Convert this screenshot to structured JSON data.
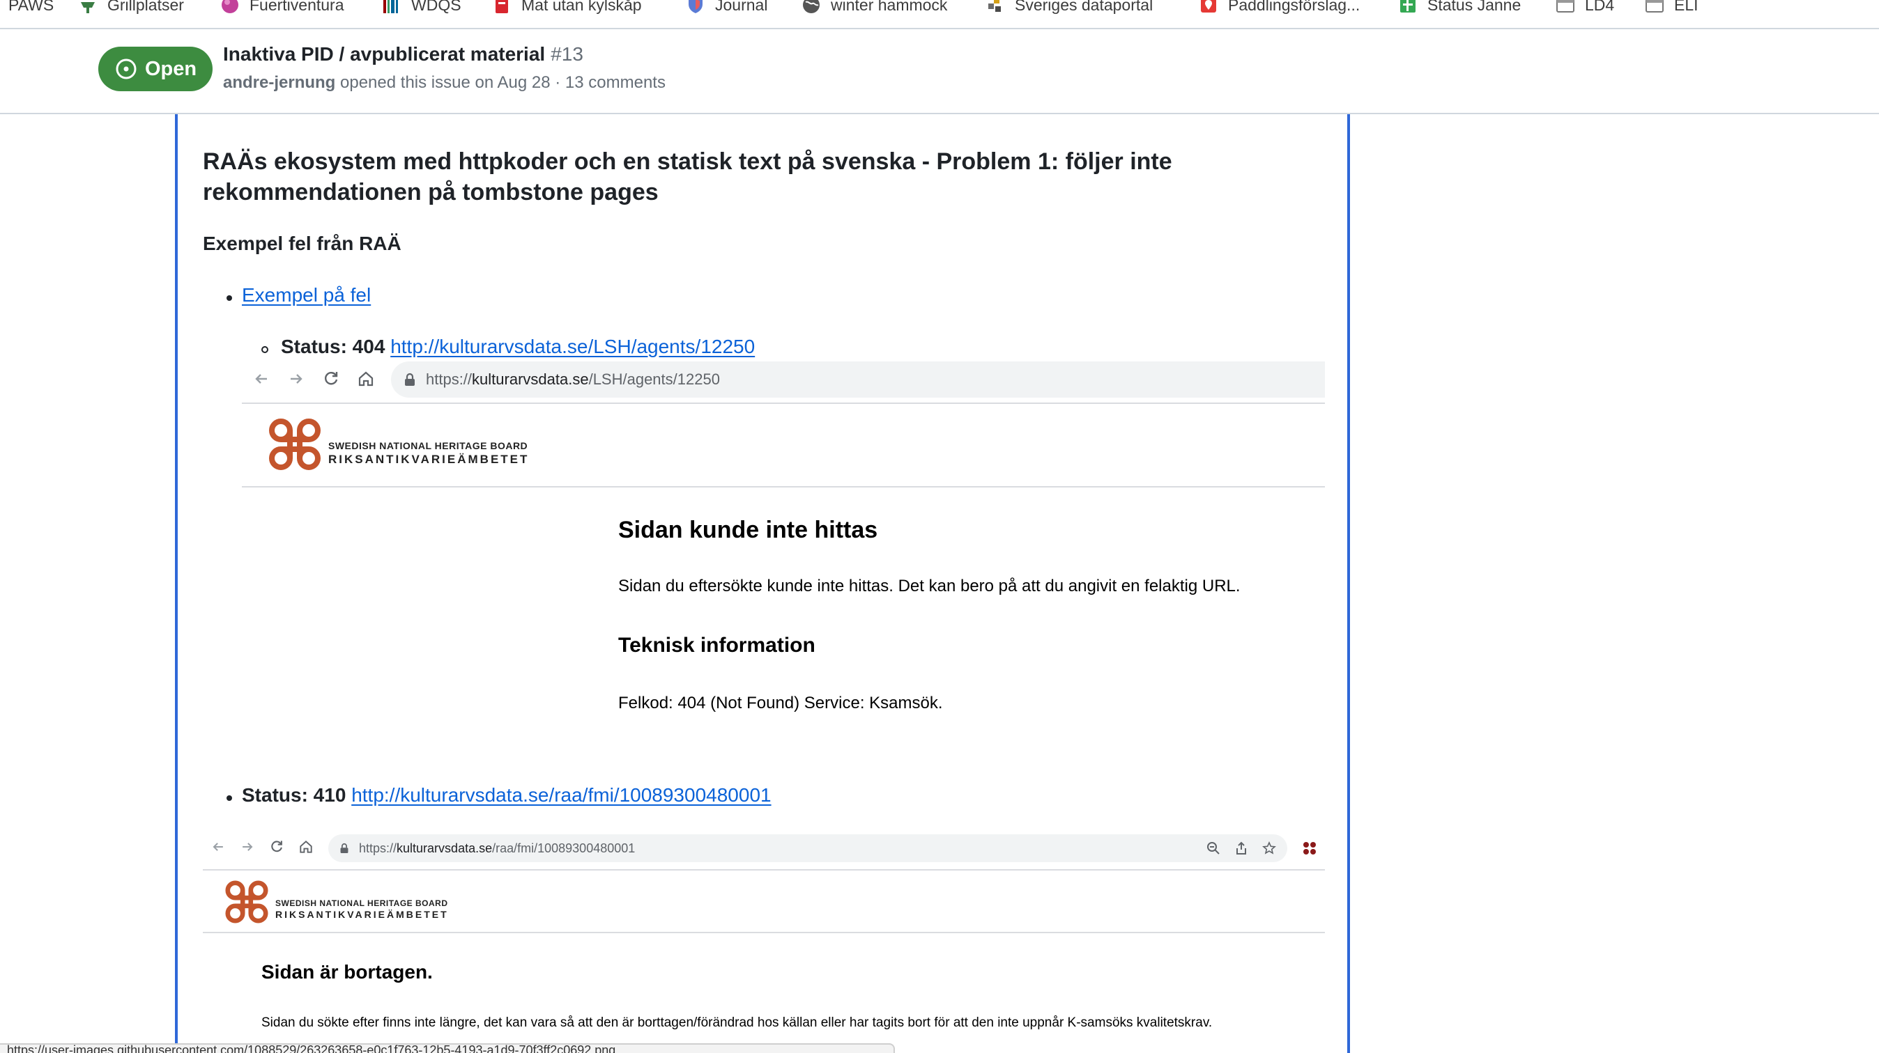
{
  "bookmarks": [
    {
      "label": "PAWS",
      "icon": "paws-icon"
    },
    {
      "label": "Grillplatser",
      "icon": "grill-icon"
    },
    {
      "label": "Fuertiventura",
      "icon": "globe-ball-icon"
    },
    {
      "label": "WDQS",
      "icon": "wdqs-icon"
    },
    {
      "label": "Mat utan kylskåp",
      "icon": "food-icon"
    },
    {
      "label": "Journal",
      "icon": "shield-icon"
    },
    {
      "label": "winter hammock",
      "icon": "world-icon"
    },
    {
      "label": "Sveriges dataportal",
      "icon": "dataportal-icon"
    },
    {
      "label": "Paddlingsförslag...",
      "icon": "map-pin-icon"
    },
    {
      "label": "Status Janne",
      "icon": "sheet-icon"
    },
    {
      "label": "LD4",
      "icon": "folder-icon"
    },
    {
      "label": "ELI",
      "icon": "folder-icon"
    }
  ],
  "issue": {
    "state_label": "Open",
    "title": "Inaktiva PID / avpublicerat material",
    "number": "#13",
    "author": "andre-jernung",
    "meta": "opened this issue on Aug 28 · 13 comments"
  },
  "comment": {
    "heading": "RAÄs ekosystem med httpkoder och en statisk text på svenska - Problem 1: följer inte rekommendationen på tombstone pages",
    "subheading": "Exempel fel från RAÄ",
    "item1_link": "Exempel på fel",
    "item1_1_status": "Status: 404",
    "item1_1_link": "http://kulturarvsdata.se/LSH/agents/12250",
    "item2_status": "Status: 410",
    "item2_link": "http://kulturarvsdata.se/raa/fmi/10089300480001"
  },
  "shot1": {
    "url_prefix": "https://",
    "url_domain": "kulturarvsdata.se",
    "url_path": "/LSH/agents/12250",
    "logo_line1": "SWEDISH NATIONAL HERITAGE BOARD",
    "logo_line2": "RIKSANTIKVARIEÄMBETET",
    "title": "Sidan kunde inte hittas",
    "text": "Sidan du eftersökte kunde inte hittas. Det kan bero på att du angivit en felaktig URL.",
    "h2": "Teknisk information",
    "code": "Felkod: 404 (Not Found) Service: Ksamsök."
  },
  "shot2": {
    "url_prefix": "https://",
    "url_domain": "kulturarvsdata.se",
    "url_path": "/raa/fmi/10089300480001",
    "logo_line1": "SWEDISH NATIONAL HERITAGE BOARD",
    "logo_line2": "RIKSANTIKVARIEÄMBETET",
    "title": "Sidan är bortagen.",
    "text": "Sidan du sökte efter finns inte längre, det kan vara så att den är borttagen/förändrad hos källan eller har tagits bort för att den inte uppnår K-samsöks kvalitetskrav."
  },
  "statusbar": {
    "text": "https://user-images.githubusercontent.com/1088529/263263658-e0c1f763-12b5-4193-a1d9-70f3ff2c0692.png"
  },
  "colors": {
    "open_green": "#3d8c40",
    "link_blue": "#0b62d8",
    "raa_orange": "#c4552c",
    "focus_blue": "#2f68d8"
  }
}
